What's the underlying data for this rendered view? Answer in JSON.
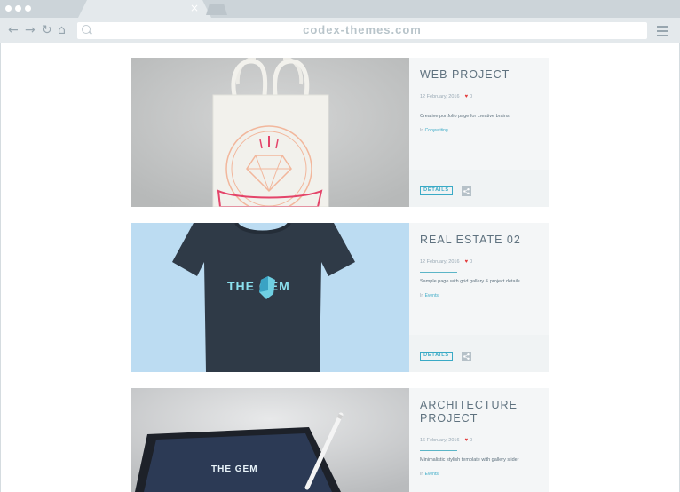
{
  "browser": {
    "url": "codex-themes.com",
    "tab_close": "×",
    "back": "←",
    "forward": "→",
    "reload": "↻",
    "home": "⌂"
  },
  "projects": [
    {
      "title": "WEB PROJECT",
      "date": "12 February, 2016",
      "likes": "0",
      "description": "Creative portfolio page for creative brains",
      "category_prefix": "In",
      "category": "Copywriting",
      "details_label": "DETAILS"
    },
    {
      "title": "REAL ESTATE 02",
      "date": "12 February, 2016",
      "likes": "0",
      "description": "Sample page with grid gallery & project details",
      "category_prefix": "In",
      "category": "Events",
      "details_label": "DETAILS",
      "image_text": "THE GEM"
    },
    {
      "title": "ARCHITECTURE PROJECT",
      "date": "16 February, 2016",
      "likes": "0",
      "description": "Minimalistic stylish template with gallery slider",
      "category_prefix": "In",
      "category": "Events",
      "image_text": "THE GEM"
    }
  ],
  "colors": {
    "accent": "#3aaac6",
    "heart": "#e33b3b",
    "title": "#5f727f"
  }
}
